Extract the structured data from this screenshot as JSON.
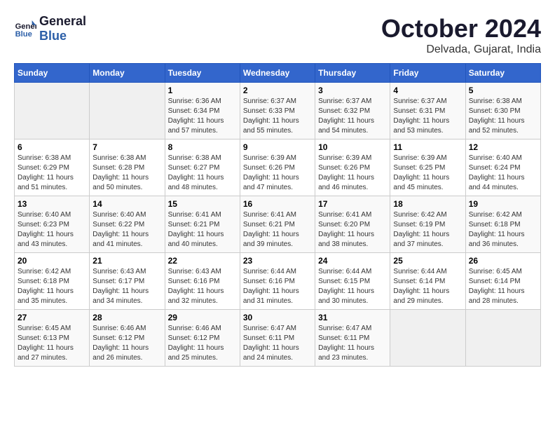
{
  "header": {
    "logo_line1": "General",
    "logo_line2": "Blue",
    "month_title": "October 2024",
    "subtitle": "Delvada, Gujarat, India"
  },
  "weekdays": [
    "Sunday",
    "Monday",
    "Tuesday",
    "Wednesday",
    "Thursday",
    "Friday",
    "Saturday"
  ],
  "weeks": [
    [
      {
        "day": "",
        "sunrise": "",
        "sunset": "",
        "daylight": ""
      },
      {
        "day": "",
        "sunrise": "",
        "sunset": "",
        "daylight": ""
      },
      {
        "day": "1",
        "sunrise": "Sunrise: 6:36 AM",
        "sunset": "Sunset: 6:34 PM",
        "daylight": "Daylight: 11 hours and 57 minutes."
      },
      {
        "day": "2",
        "sunrise": "Sunrise: 6:37 AM",
        "sunset": "Sunset: 6:33 PM",
        "daylight": "Daylight: 11 hours and 55 minutes."
      },
      {
        "day": "3",
        "sunrise": "Sunrise: 6:37 AM",
        "sunset": "Sunset: 6:32 PM",
        "daylight": "Daylight: 11 hours and 54 minutes."
      },
      {
        "day": "4",
        "sunrise": "Sunrise: 6:37 AM",
        "sunset": "Sunset: 6:31 PM",
        "daylight": "Daylight: 11 hours and 53 minutes."
      },
      {
        "day": "5",
        "sunrise": "Sunrise: 6:38 AM",
        "sunset": "Sunset: 6:30 PM",
        "daylight": "Daylight: 11 hours and 52 minutes."
      }
    ],
    [
      {
        "day": "6",
        "sunrise": "Sunrise: 6:38 AM",
        "sunset": "Sunset: 6:29 PM",
        "daylight": "Daylight: 11 hours and 51 minutes."
      },
      {
        "day": "7",
        "sunrise": "Sunrise: 6:38 AM",
        "sunset": "Sunset: 6:28 PM",
        "daylight": "Daylight: 11 hours and 50 minutes."
      },
      {
        "day": "8",
        "sunrise": "Sunrise: 6:38 AM",
        "sunset": "Sunset: 6:27 PM",
        "daylight": "Daylight: 11 hours and 48 minutes."
      },
      {
        "day": "9",
        "sunrise": "Sunrise: 6:39 AM",
        "sunset": "Sunset: 6:26 PM",
        "daylight": "Daylight: 11 hours and 47 minutes."
      },
      {
        "day": "10",
        "sunrise": "Sunrise: 6:39 AM",
        "sunset": "Sunset: 6:26 PM",
        "daylight": "Daylight: 11 hours and 46 minutes."
      },
      {
        "day": "11",
        "sunrise": "Sunrise: 6:39 AM",
        "sunset": "Sunset: 6:25 PM",
        "daylight": "Daylight: 11 hours and 45 minutes."
      },
      {
        "day": "12",
        "sunrise": "Sunrise: 6:40 AM",
        "sunset": "Sunset: 6:24 PM",
        "daylight": "Daylight: 11 hours and 44 minutes."
      }
    ],
    [
      {
        "day": "13",
        "sunrise": "Sunrise: 6:40 AM",
        "sunset": "Sunset: 6:23 PM",
        "daylight": "Daylight: 11 hours and 43 minutes."
      },
      {
        "day": "14",
        "sunrise": "Sunrise: 6:40 AM",
        "sunset": "Sunset: 6:22 PM",
        "daylight": "Daylight: 11 hours and 41 minutes."
      },
      {
        "day": "15",
        "sunrise": "Sunrise: 6:41 AM",
        "sunset": "Sunset: 6:21 PM",
        "daylight": "Daylight: 11 hours and 40 minutes."
      },
      {
        "day": "16",
        "sunrise": "Sunrise: 6:41 AM",
        "sunset": "Sunset: 6:21 PM",
        "daylight": "Daylight: 11 hours and 39 minutes."
      },
      {
        "day": "17",
        "sunrise": "Sunrise: 6:41 AM",
        "sunset": "Sunset: 6:20 PM",
        "daylight": "Daylight: 11 hours and 38 minutes."
      },
      {
        "day": "18",
        "sunrise": "Sunrise: 6:42 AM",
        "sunset": "Sunset: 6:19 PM",
        "daylight": "Daylight: 11 hours and 37 minutes."
      },
      {
        "day": "19",
        "sunrise": "Sunrise: 6:42 AM",
        "sunset": "Sunset: 6:18 PM",
        "daylight": "Daylight: 11 hours and 36 minutes."
      }
    ],
    [
      {
        "day": "20",
        "sunrise": "Sunrise: 6:42 AM",
        "sunset": "Sunset: 6:18 PM",
        "daylight": "Daylight: 11 hours and 35 minutes."
      },
      {
        "day": "21",
        "sunrise": "Sunrise: 6:43 AM",
        "sunset": "Sunset: 6:17 PM",
        "daylight": "Daylight: 11 hours and 34 minutes."
      },
      {
        "day": "22",
        "sunrise": "Sunrise: 6:43 AM",
        "sunset": "Sunset: 6:16 PM",
        "daylight": "Daylight: 11 hours and 32 minutes."
      },
      {
        "day": "23",
        "sunrise": "Sunrise: 6:44 AM",
        "sunset": "Sunset: 6:16 PM",
        "daylight": "Daylight: 11 hours and 31 minutes."
      },
      {
        "day": "24",
        "sunrise": "Sunrise: 6:44 AM",
        "sunset": "Sunset: 6:15 PM",
        "daylight": "Daylight: 11 hours and 30 minutes."
      },
      {
        "day": "25",
        "sunrise": "Sunrise: 6:44 AM",
        "sunset": "Sunset: 6:14 PM",
        "daylight": "Daylight: 11 hours and 29 minutes."
      },
      {
        "day": "26",
        "sunrise": "Sunrise: 6:45 AM",
        "sunset": "Sunset: 6:14 PM",
        "daylight": "Daylight: 11 hours and 28 minutes."
      }
    ],
    [
      {
        "day": "27",
        "sunrise": "Sunrise: 6:45 AM",
        "sunset": "Sunset: 6:13 PM",
        "daylight": "Daylight: 11 hours and 27 minutes."
      },
      {
        "day": "28",
        "sunrise": "Sunrise: 6:46 AM",
        "sunset": "Sunset: 6:12 PM",
        "daylight": "Daylight: 11 hours and 26 minutes."
      },
      {
        "day": "29",
        "sunrise": "Sunrise: 6:46 AM",
        "sunset": "Sunset: 6:12 PM",
        "daylight": "Daylight: 11 hours and 25 minutes."
      },
      {
        "day": "30",
        "sunrise": "Sunrise: 6:47 AM",
        "sunset": "Sunset: 6:11 PM",
        "daylight": "Daylight: 11 hours and 24 minutes."
      },
      {
        "day": "31",
        "sunrise": "Sunrise: 6:47 AM",
        "sunset": "Sunset: 6:11 PM",
        "daylight": "Daylight: 11 hours and 23 minutes."
      },
      {
        "day": "",
        "sunrise": "",
        "sunset": "",
        "daylight": ""
      },
      {
        "day": "",
        "sunrise": "",
        "sunset": "",
        "daylight": ""
      }
    ]
  ]
}
